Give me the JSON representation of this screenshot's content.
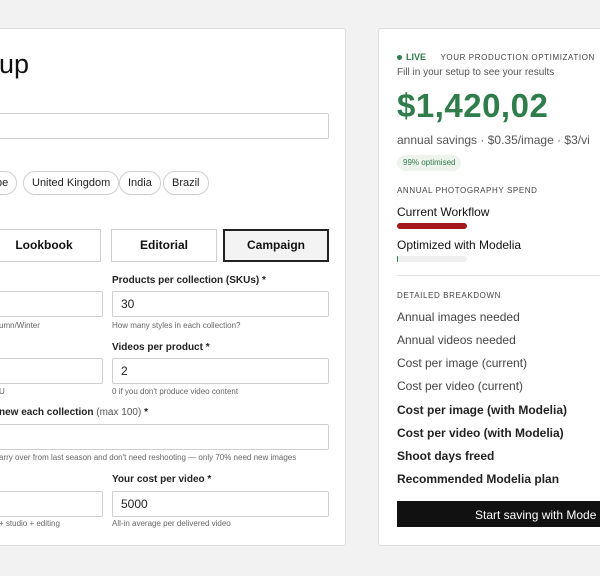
{
  "setup": {
    "title": "up",
    "countries": [
      "pe",
      "United Kingdom",
      "India",
      "Brazil"
    ],
    "tabs": [
      "Lookbook",
      "Editorial",
      "Campaign"
    ],
    "active_tab": "Campaign",
    "fields": {
      "products": {
        "label": "Products per collection (SKUs)",
        "required": "*",
        "value": "30",
        "help": "How many styles in each collection?"
      },
      "left1": {
        "help": "umn/Winter"
      },
      "videos": {
        "label": "Videos per product",
        "required": "*",
        "value": "2",
        "help": "0 if you don't produce video content"
      },
      "left2": {
        "help": "U"
      },
      "new_each": {
        "label": "new each collection",
        "hint": "(max 100)",
        "required": "*",
        "help": "arry over from last season and don't need reshooting — only 70% need new images"
      },
      "cost_video": {
        "label": "Your cost per video",
        "required": "*",
        "value": "5000",
        "help": "All-in average per delivered video"
      },
      "left3": {
        "help": "+ studio + editing"
      }
    }
  },
  "results": {
    "live": "LIVE",
    "heading": "YOUR PRODUCTION OPTIMIZATION",
    "prompt": "Fill in your setup to see your results",
    "savings": "$1,420,02",
    "savings_sub": "annual savings · $0.35/image · $3/vi",
    "optimised_pill": "99% optimised",
    "spend_heading": "ANNUAL PHOTOGRAPHY SPEND",
    "current_label": "Current Workflow",
    "optimized_label": "Optimized with Modelia",
    "current_fraction": 1.0,
    "optimized_fraction": 0.01,
    "breakdown_heading": "DETAILED BREAKDOWN",
    "breakdown": [
      "Annual images needed",
      "Annual videos needed",
      "Cost per image (current)",
      "Cost per video (current)",
      "Cost per image (with Modelia)",
      "Cost per video (with Modelia)",
      "Shoot days freed",
      "Recommended Modelia plan"
    ],
    "cta": "Start saving with Mode"
  },
  "colors": {
    "accent": "#2e7d4a",
    "danger_bar": "#a3161c",
    "dark": "#111111"
  }
}
